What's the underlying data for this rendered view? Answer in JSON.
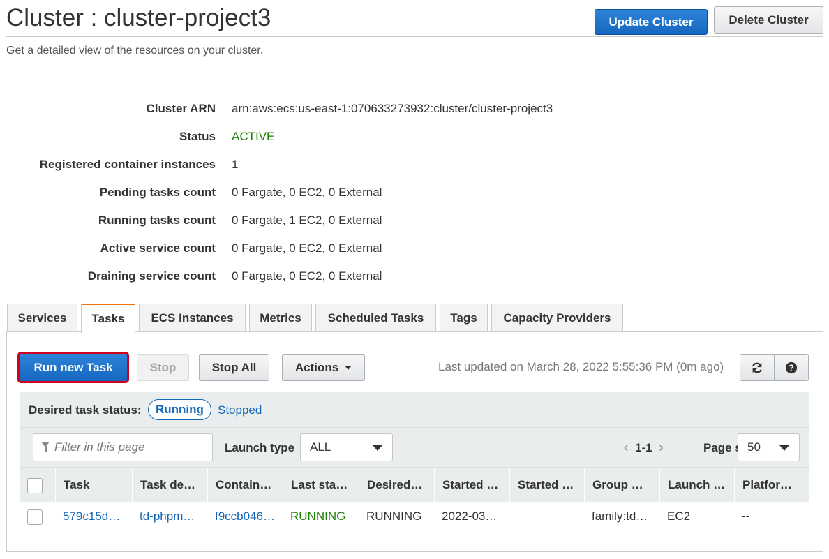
{
  "page": {
    "title": "Cluster : cluster-project3",
    "subtitle": "Get a detailed view of the resources on your cluster."
  },
  "header_buttons": {
    "update": "Update Cluster",
    "delete": "Delete Cluster"
  },
  "details": [
    {
      "label": "Cluster ARN",
      "value": "arn:aws:ecs:us-east-1:070633273932:cluster/cluster-project3"
    },
    {
      "label": "Status",
      "value": "ACTIVE"
    },
    {
      "label": "Registered container instances",
      "value": "1"
    },
    {
      "label": "Pending tasks count",
      "value": "0 Fargate, 0 EC2, 0 External"
    },
    {
      "label": "Running tasks count",
      "value": "0 Fargate, 1 EC2, 0 External"
    },
    {
      "label": "Active service count",
      "value": "0 Fargate, 0 EC2, 0 External"
    },
    {
      "label": "Draining service count",
      "value": "0 Fargate, 0 EC2, 0 External"
    }
  ],
  "tabs": [
    {
      "label": "Services",
      "active": false
    },
    {
      "label": "Tasks",
      "active": true
    },
    {
      "label": "ECS Instances",
      "active": false
    },
    {
      "label": "Metrics",
      "active": false
    },
    {
      "label": "Scheduled Tasks",
      "active": false
    },
    {
      "label": "Tags",
      "active": false
    },
    {
      "label": "Capacity Providers",
      "active": false
    }
  ],
  "toolbar": {
    "run_new_task": "Run new Task",
    "stop": "Stop",
    "stop_all": "Stop All",
    "actions": "Actions",
    "last_updated": "Last updated on March 28, 2022 5:55:36 PM (0m ago)",
    "refresh_icon": "refresh-icon",
    "help_icon": "help-icon"
  },
  "status_filter": {
    "label": "Desired task status:",
    "running": "Running",
    "stopped": "Stopped"
  },
  "filter": {
    "placeholder": "Filter in this page",
    "launch_type_label": "Launch type",
    "launch_type_value": "ALL",
    "pager_prev": "‹",
    "pager_range": "1-1",
    "pager_next": "›",
    "page_size_label": "Page size",
    "page_size_value": "50"
  },
  "table": {
    "columns": [
      "Task",
      "Task de…",
      "Contain…",
      "Last sta…",
      "Desired…",
      "Started …",
      "Started …",
      "Group …",
      "Launch …",
      "Platfor…"
    ],
    "rows": [
      [
        "579c15d…",
        "td-phpm…",
        "f9ccb046…",
        "RUNNING",
        "RUNNING",
        "2022-03…",
        "",
        "family:td…",
        "EC2",
        "--"
      ]
    ]
  },
  "colors": {
    "primary": "#1566c0",
    "active_green": "#1d8102",
    "link_blue": "#1466b8",
    "tab_accent": "#ec7211",
    "highlight_red": "#d0021b"
  }
}
